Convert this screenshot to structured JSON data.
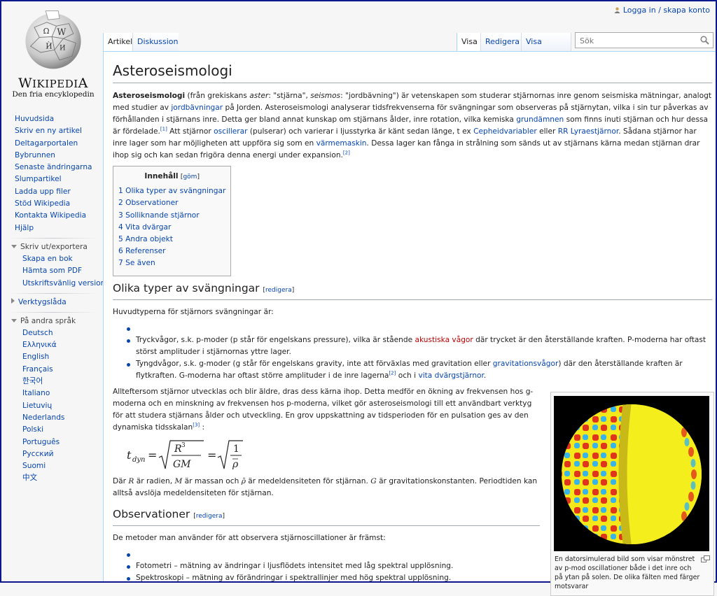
{
  "personal": {
    "login": "Logga in / skapa konto"
  },
  "logo": {
    "wordmark": "Wikipedia",
    "tagline": "Den fria encyklopedin"
  },
  "nav": {
    "main": [
      "Huvudsida",
      "Skriv en ny artikel",
      "Deltagarportalen",
      "Bybrunnen",
      "Senaste ändringarna",
      "Slumpartikel",
      "Ladda upp filer",
      "Stöd Wikipedia",
      "Kontakta Wikipedia",
      "Hjälp"
    ],
    "print_heading": "Skriv ut/exportera",
    "print_items": [
      "Skapa en bok",
      "Hämta som PDF",
      "Utskriftsvänlig version"
    ],
    "tools_heading": "Verktygslåda",
    "lang_heading": "På andra språk",
    "languages": [
      "Deutsch",
      "Ελληνικά",
      "English",
      "Français",
      "한국어",
      "Italiano",
      "Lietuvių",
      "Nederlands",
      "Polski",
      "Português",
      "Русский",
      "Suomi",
      "中文"
    ]
  },
  "tabs": {
    "article": "Artikel",
    "discussion": "Diskussion",
    "view": "Visa",
    "edit": "Redigera",
    "history": "Visa historik"
  },
  "search": {
    "placeholder": "Sök"
  },
  "article": {
    "title": "Asteroseismologi",
    "intro": {
      "bold": "Asteroseismologi",
      "t1": " (från grekiskans ",
      "aster": "aster",
      "t2": ": \"stjärna\", ",
      "seismos": "seismos",
      "t3": ": \"jordbävning\") är vetenskapen som studerar stjärnornas inre genom seismiska mätningar, analogt med studier av ",
      "l_jord": "jordbävningar",
      "t4": " på Jorden. Asteroseismologi analyserar tidsfrekvenserna för svängningar som observeras på stjärnytan, vilka i sin tur påverkas av förhållanden i stjärnans inre. Detta ger bland annat kunskap om stjärnans ålder, inre rotation, vilka kemiska ",
      "l_grund": "grundämnen",
      "t5": " som finns inuti stjärnan och hur dessa är fördelade.",
      "ref1": "[1]",
      "t6": " Att stjärnor ",
      "l_osc": "oscillerar",
      "t7": " (pulserar) och varierar i ljusstyrka är känt sedan länge, t ex ",
      "l_ceph": "Cepheidvariabler",
      "t8": " eller ",
      "l_rr": "RR Lyraestjärnor",
      "t9": ". Sådana stjärnor har inre lager som har möjligheten att uppföra sig som en ",
      "l_varme": "värmemaskin",
      "t10": ". Dessa lager kan fånga in strålning som sänds ut av stjärnans kärna medan stjärnan drar ihop sig och kan sedan frigöra denna energi under expansion.",
      "ref2": "[2]"
    },
    "toc": {
      "title": "Innehåll",
      "hide": "göm",
      "items": [
        "1 Olika typer av svängningar",
        "2 Observationer",
        "3 Solliknande stjärnor",
        "4 Vita dvärgar",
        "5 Andra objekt",
        "6 Referenser",
        "7 Se även"
      ]
    },
    "s1": {
      "heading": "Olika typer av svängningar",
      "edit": "redigera",
      "lead": "Huvudtyperna för stjärnors svängningar är:",
      "b1a": "Tryckvågor, s.k. p-moder (p står för engelskans pressure), vilka är stående ",
      "b1_link": "akustiska vågor",
      "b1b": " där trycket är den återställande kraften. P-moderna har oftast störst amplituder i stjärnornas yttre lager.",
      "b2a": "Tyngdvågor, s.k. g-moder (g står för engelskans gravity, inte att förväxlas med gravitation eller ",
      "b2_link1": "gravitationsvågor",
      "b2b": ") där den återställande kraften är flytkraften. G-moderna har oftast större amplituder i de inre lagerna",
      "b2_ref": "[2]",
      "b2c": " och i ",
      "b2_link2": "vita dvärgstjärnor",
      "b2d": ".",
      "p2a": "Allteftersom stjärnor utvecklas och blir äldre, dras dess kärna ihop. Detta medför en ökning av frekvensen hos g-moderna och en minskning av frekvensen hos p-moderna, vilket gör asteroseismologi till ett användbart verktyg för att studera stjärnans ålder och utveckling. En grov uppskattning av tidsperioden för en pulsation ges av den dynamiska tidsskalan",
      "p2_ref": "[3]",
      "p2b": " :",
      "p3a": "Där ",
      "p3_R": "R",
      "p3b": " är radien, ",
      "p3_M": "M",
      "p3c": " är massan och ",
      "p3_rho": "ρ̄",
      "p3d": " är medeldensiteten för stjärnan. ",
      "p3_G": "G",
      "p3e": " är gravitationskonstanten. Periodtiden kan alltså avslöja medeldensiteten för stjärnan."
    },
    "s2": {
      "heading": "Observationer",
      "edit": "redigera",
      "lead": "De metoder man använder för att observera stjärnoscillationer är främst:",
      "b1": "Fotometri – mätning av ändringar i ljusflödets intensitet med låg spektral upplösning.",
      "b2": "Spektroskopi – mätning av förändringar i spektrallinjer med hög spektral upplösning."
    },
    "thumb": {
      "caption": "En datorsimulerad bild som visar mönstret av p-mod oscillationer både i det inre och på ytan på solen. De olika fälten med färger motsvarar"
    }
  }
}
